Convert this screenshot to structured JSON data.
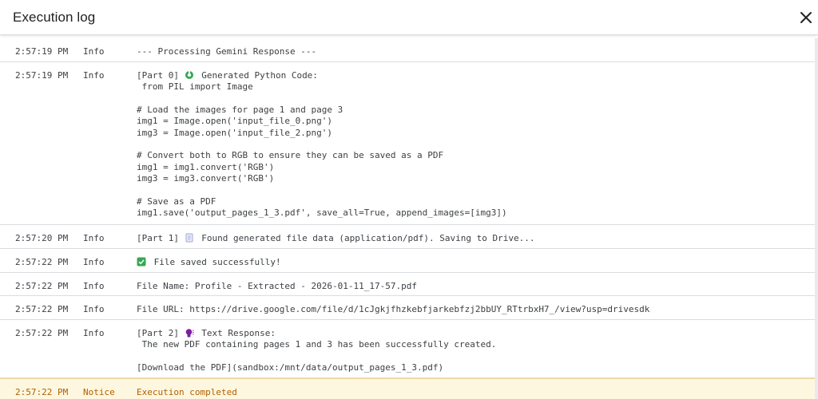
{
  "header": {
    "title": "Execution log",
    "close_icon": "close-icon"
  },
  "log": {
    "entries": [
      {
        "time": "2:57:19 PM",
        "level": "Info",
        "message": "--- Processing Gemini Response ---"
      },
      {
        "time": "2:57:19 PM",
        "level": "Info",
        "prefix": "[Part 0]",
        "icon": "python-icon",
        "message": "Generated Python Code:\n from PIL import Image\n\n# Load the images for page 1 and page 3\nimg1 = Image.open('input_file_0.png')\nimg3 = Image.open('input_file_2.png')\n\n# Convert both to RGB to ensure they can be saved as a PDF\nimg1 = img1.convert('RGB')\nimg3 = img3.convert('RGB')\n\n# Save as a PDF\nimg1.save('output_pages_1_3.pdf', save_all=True, append_images=[img3])"
      },
      {
        "time": "2:57:20 PM",
        "level": "Info",
        "prefix": "[Part 1]",
        "icon": "document-icon",
        "message": "Found generated file data (application/pdf). Saving to Drive..."
      },
      {
        "time": "2:57:22 PM",
        "level": "Info",
        "icon": "check-icon",
        "message": "File saved successfully!"
      },
      {
        "time": "2:57:22 PM",
        "level": "Info",
        "message": "File Name: Profile - Extracted - 2026-01-11_17-57.pdf"
      },
      {
        "time": "2:57:22 PM",
        "level": "Info",
        "message": "File URL: https://drive.google.com/file/d/1cJgkjfhzkebfjarkebfzj2bbUY_RTtrbxH7_/view?usp=drivesdk"
      },
      {
        "time": "2:57:22 PM",
        "level": "Info",
        "prefix": "[Part 2]",
        "icon": "speaking-head-icon",
        "message": "Text Response:\n The new PDF containing pages 1 and 3 has been successfully created.\n\n[Download the PDF](sandbox:/mnt/data/output_pages_1_3.pdf)"
      },
      {
        "time": "2:57:22 PM",
        "level": "Notice",
        "message": "Execution completed"
      }
    ]
  },
  "colors": {
    "notice_background": "#fef7e0",
    "notice_text": "#b06000",
    "divider": "#dadce0"
  }
}
